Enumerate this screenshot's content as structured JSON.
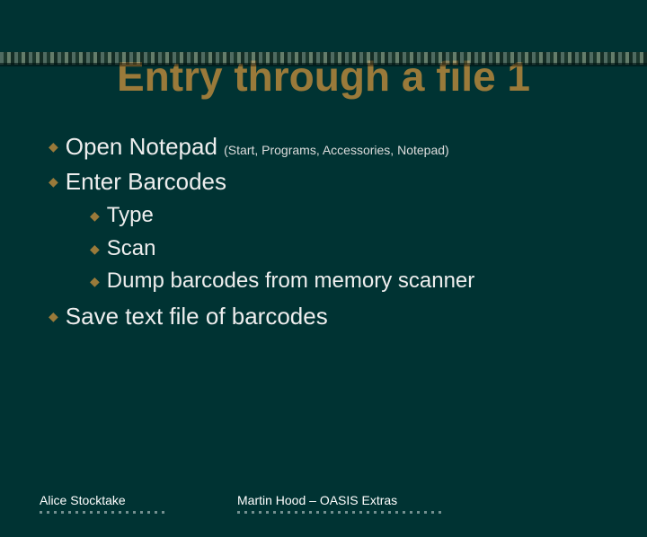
{
  "title": "Entry through a file 1",
  "bullets": {
    "b1_prefix": "Open",
    "b1_bold": " Notepad ",
    "b1_note": "(Start, Programs, Accessories, Notepad)",
    "b2": " Enter Barcodes",
    "s1": "Type",
    "s2": "Scan",
    "s3": "Dump barcodes from memory scanner",
    "b3": "Save text file of barcodes"
  },
  "footer": {
    "left": "Alice Stocktake",
    "right": "Martin Hood – OASIS Extras"
  }
}
